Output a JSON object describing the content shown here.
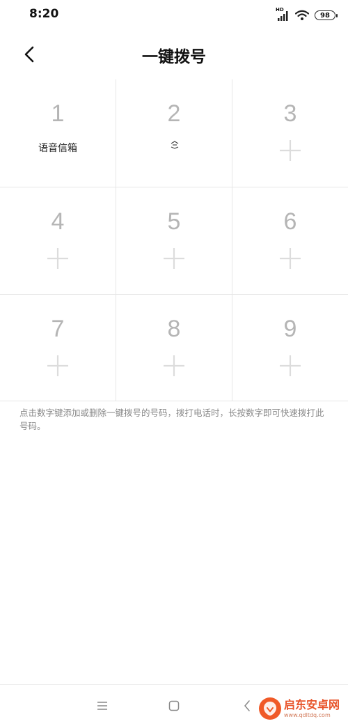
{
  "status_bar": {
    "time": "8:20",
    "network_label": "HD",
    "battery": "98"
  },
  "header": {
    "title": "一键拨号"
  },
  "keys": [
    {
      "number": "1",
      "label": "语音信箱",
      "state": "voicemail"
    },
    {
      "number": "2",
      "label": "",
      "state": "assigned-contact"
    },
    {
      "number": "3",
      "label": "",
      "state": "empty"
    },
    {
      "number": "4",
      "label": "",
      "state": "empty"
    },
    {
      "number": "5",
      "label": "",
      "state": "empty"
    },
    {
      "number": "6",
      "label": "",
      "state": "empty"
    },
    {
      "number": "7",
      "label": "",
      "state": "empty"
    },
    {
      "number": "8",
      "label": "",
      "state": "empty"
    },
    {
      "number": "9",
      "label": "",
      "state": "empty"
    }
  ],
  "hint": "点击数字键添加或删除一键拨号的号码，拨打电话时，长按数字即可快速拨打此号码。",
  "watermark": {
    "title": "启东安卓网",
    "url": "www.qdltdq.com"
  },
  "colors": {
    "number": "#b5b5b5",
    "plus": "#dcdcdc",
    "divider": "#e6e6e6",
    "hint": "#8a8a8a",
    "watermark": "#e8542a"
  }
}
